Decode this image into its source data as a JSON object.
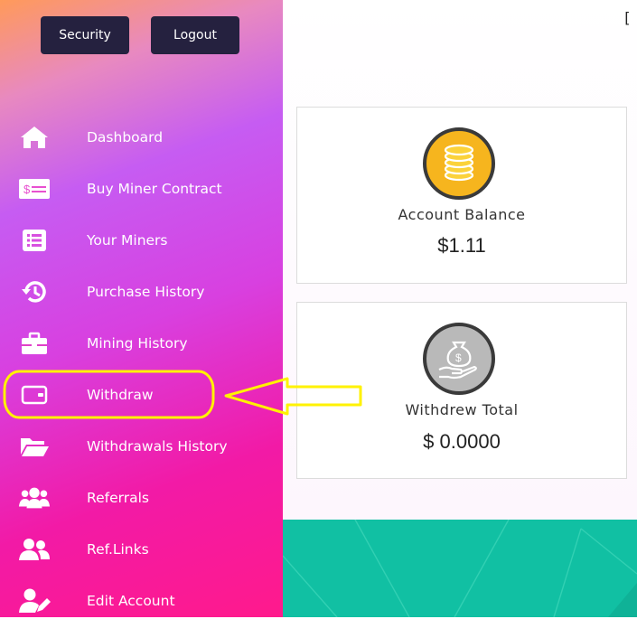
{
  "header": {
    "security_label": "Security",
    "logout_label": "Logout",
    "corner_glyph": "["
  },
  "sidebar": {
    "items": [
      {
        "label": "Dashboard",
        "icon": "home-icon"
      },
      {
        "label": "Buy Miner Contract",
        "icon": "money-bill-icon"
      },
      {
        "label": "Your Miners",
        "icon": "list-icon"
      },
      {
        "label": "Purchase History",
        "icon": "history-icon"
      },
      {
        "label": "Mining History",
        "icon": "briefcase-icon"
      },
      {
        "label": "Withdraw",
        "icon": "wallet-icon"
      },
      {
        "label": "Withdrawals History",
        "icon": "folder-open-icon"
      },
      {
        "label": "Referrals",
        "icon": "users-icon"
      },
      {
        "label": "Ref.Links",
        "icon": "user-friends-icon"
      },
      {
        "label": "Edit Account",
        "icon": "user-edit-icon"
      }
    ],
    "highlight_color": "#fff200"
  },
  "cards": {
    "balance": {
      "title": "Account Balance",
      "value": "$1.11",
      "icon": "coins-icon",
      "icon_color": "#f6b51e"
    },
    "withdrawn": {
      "title": "Withdrew Total",
      "value": "$ 0.0000",
      "icon": "hand-money-bag-icon",
      "icon_color": "#b9b9b9"
    }
  },
  "colors": {
    "button_bg": "#25213f",
    "footer_teal": "#11c0a3",
    "sidebar_top": "#ff9a5a",
    "sidebar_bottom": "#ff1a8c"
  }
}
